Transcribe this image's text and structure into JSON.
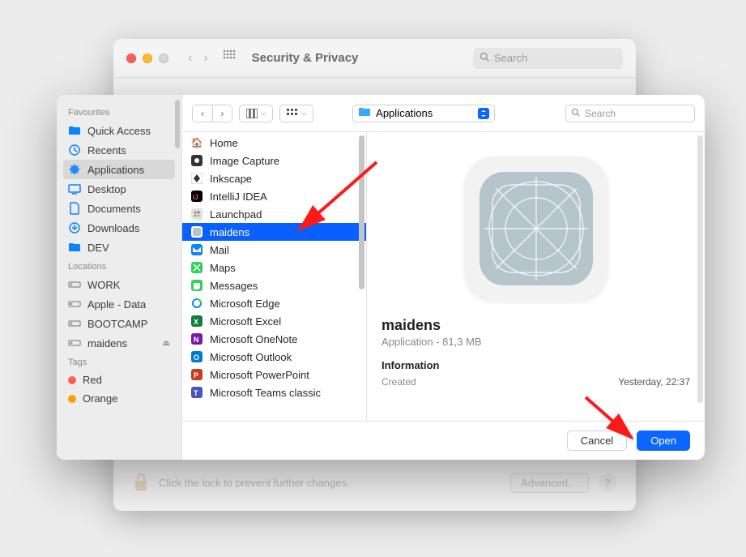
{
  "bg": {
    "title": "Security & Privacy",
    "search_placeholder": "Search",
    "lock_text": "Click the lock to prevent further changes.",
    "advanced": "Advanced…",
    "help": "?"
  },
  "sidebar": {
    "sections": {
      "favourites": "Favourites",
      "locations": "Locations",
      "tags": "Tags"
    },
    "favourites": [
      {
        "label": "Quick Access",
        "icon": "folder",
        "color": "#0a66ff"
      },
      {
        "label": "Recents",
        "icon": "clock",
        "color": "#0a66ff"
      },
      {
        "label": "Applications",
        "icon": "apps",
        "color": "#0a66ff",
        "selected": true
      },
      {
        "label": "Desktop",
        "icon": "desktop",
        "color": "#0a66ff"
      },
      {
        "label": "Documents",
        "icon": "doc",
        "color": "#0a66ff"
      },
      {
        "label": "Downloads",
        "icon": "download",
        "color": "#0a66ff"
      },
      {
        "label": "DEV",
        "icon": "folder",
        "color": "#0a66ff"
      }
    ],
    "locations": [
      {
        "label": "WORK",
        "icon": "disk"
      },
      {
        "label": "Apple - Data",
        "icon": "disk"
      },
      {
        "label": "BOOTCAMP",
        "icon": "disk"
      },
      {
        "label": "maidens",
        "icon": "disk",
        "eject": true
      }
    ],
    "tags": [
      {
        "label": "Red",
        "color": "#ff5f57"
      },
      {
        "label": "Orange",
        "color": "#ff9f0a"
      }
    ]
  },
  "toolbar": {
    "location": "Applications",
    "search_placeholder": "Search"
  },
  "list": [
    {
      "label": "Home",
      "icon": "🏠"
    },
    {
      "label": "Image Capture",
      "icon": "📷"
    },
    {
      "label": "Inkscape",
      "icon": "◆"
    },
    {
      "label": "IntelliJ IDEA",
      "icon": "IJ"
    },
    {
      "label": "Launchpad",
      "icon": "🚀"
    },
    {
      "label": "maidens",
      "icon": "▢",
      "selected": true
    },
    {
      "label": "Mail",
      "icon": "✉"
    },
    {
      "label": "Maps",
      "icon": "🗺"
    },
    {
      "label": "Messages",
      "icon": "💬"
    },
    {
      "label": "Microsoft Edge",
      "icon": "e"
    },
    {
      "label": "Microsoft Excel",
      "icon": "X"
    },
    {
      "label": "Microsoft OneNote",
      "icon": "N"
    },
    {
      "label": "Microsoft Outlook",
      "icon": "O"
    },
    {
      "label": "Microsoft PowerPoint",
      "icon": "P"
    },
    {
      "label": "Microsoft Teams classic",
      "icon": "T"
    }
  ],
  "preview": {
    "name": "maidens",
    "kind": "Application - 81,3 MB",
    "info_heading": "Information",
    "created_label": "Created",
    "created_value": "Yesterday, 22:37"
  },
  "footer": {
    "cancel": "Cancel",
    "open": "Open"
  }
}
